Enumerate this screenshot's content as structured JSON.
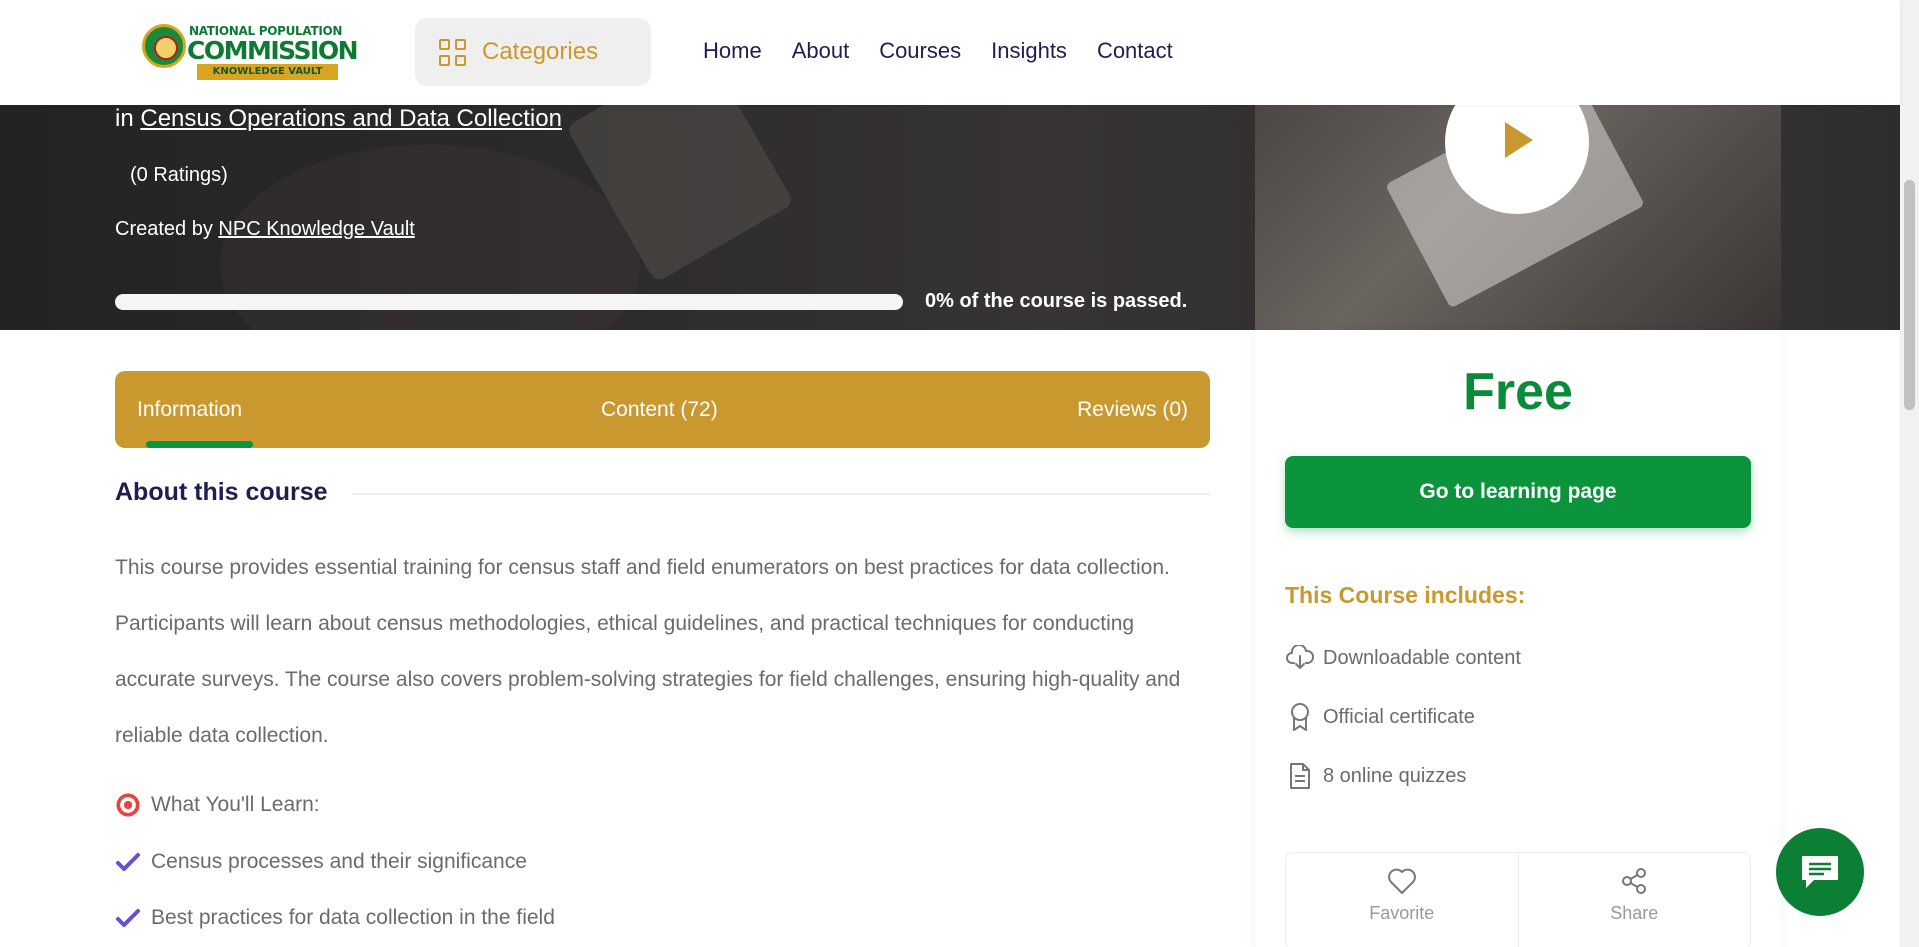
{
  "header": {
    "logo": {
      "line1": "NATIONAL POPULATION",
      "line2": "COMMISSION",
      "line3": "KNOWLEDGE VAULT"
    },
    "categories_label": "Categories",
    "nav": [
      "Home",
      "About",
      "Courses",
      "Insights",
      "Contact"
    ]
  },
  "hero": {
    "in_prefix": "in",
    "category_link": "Census Operations and Data Collection",
    "ratings": "(0 Ratings)",
    "created_prefix": "Created by",
    "creator_link": "NPC Knowledge Vault",
    "progress_percent": 0,
    "progress_text": "0% of the course is passed."
  },
  "sidebar": {
    "price": "Free",
    "learn_button": "Go to learning page",
    "includes_title": "This Course includes:",
    "includes": [
      {
        "icon": "download-cloud-icon",
        "label": "Downloadable content"
      },
      {
        "icon": "certificate-icon",
        "label": "Official certificate"
      },
      {
        "icon": "document-icon",
        "label": "8 online quizzes"
      }
    ],
    "favorite_label": "Favorite",
    "share_label": "Share"
  },
  "tabs": {
    "items": [
      "Information",
      "Content (72)",
      "Reviews (0)"
    ],
    "active": "Information"
  },
  "about": {
    "title": "About this course",
    "description": "This course provides essential training for census staff and field enumerators on best practices for data collection. Participants will learn about census methodologies, ethical guidelines, and practical techniques for conducting accurate surveys. The course also covers problem-solving strategies for field challenges, ensuring high-quality and reliable data collection.",
    "learn_heading": "What You'll Learn:",
    "learn_items": [
      "Census processes and their significance",
      "Best practices for data collection in the field"
    ]
  },
  "colors": {
    "gold": "#c9992f",
    "green": "#0b943c",
    "navy": "#1e1e50"
  }
}
